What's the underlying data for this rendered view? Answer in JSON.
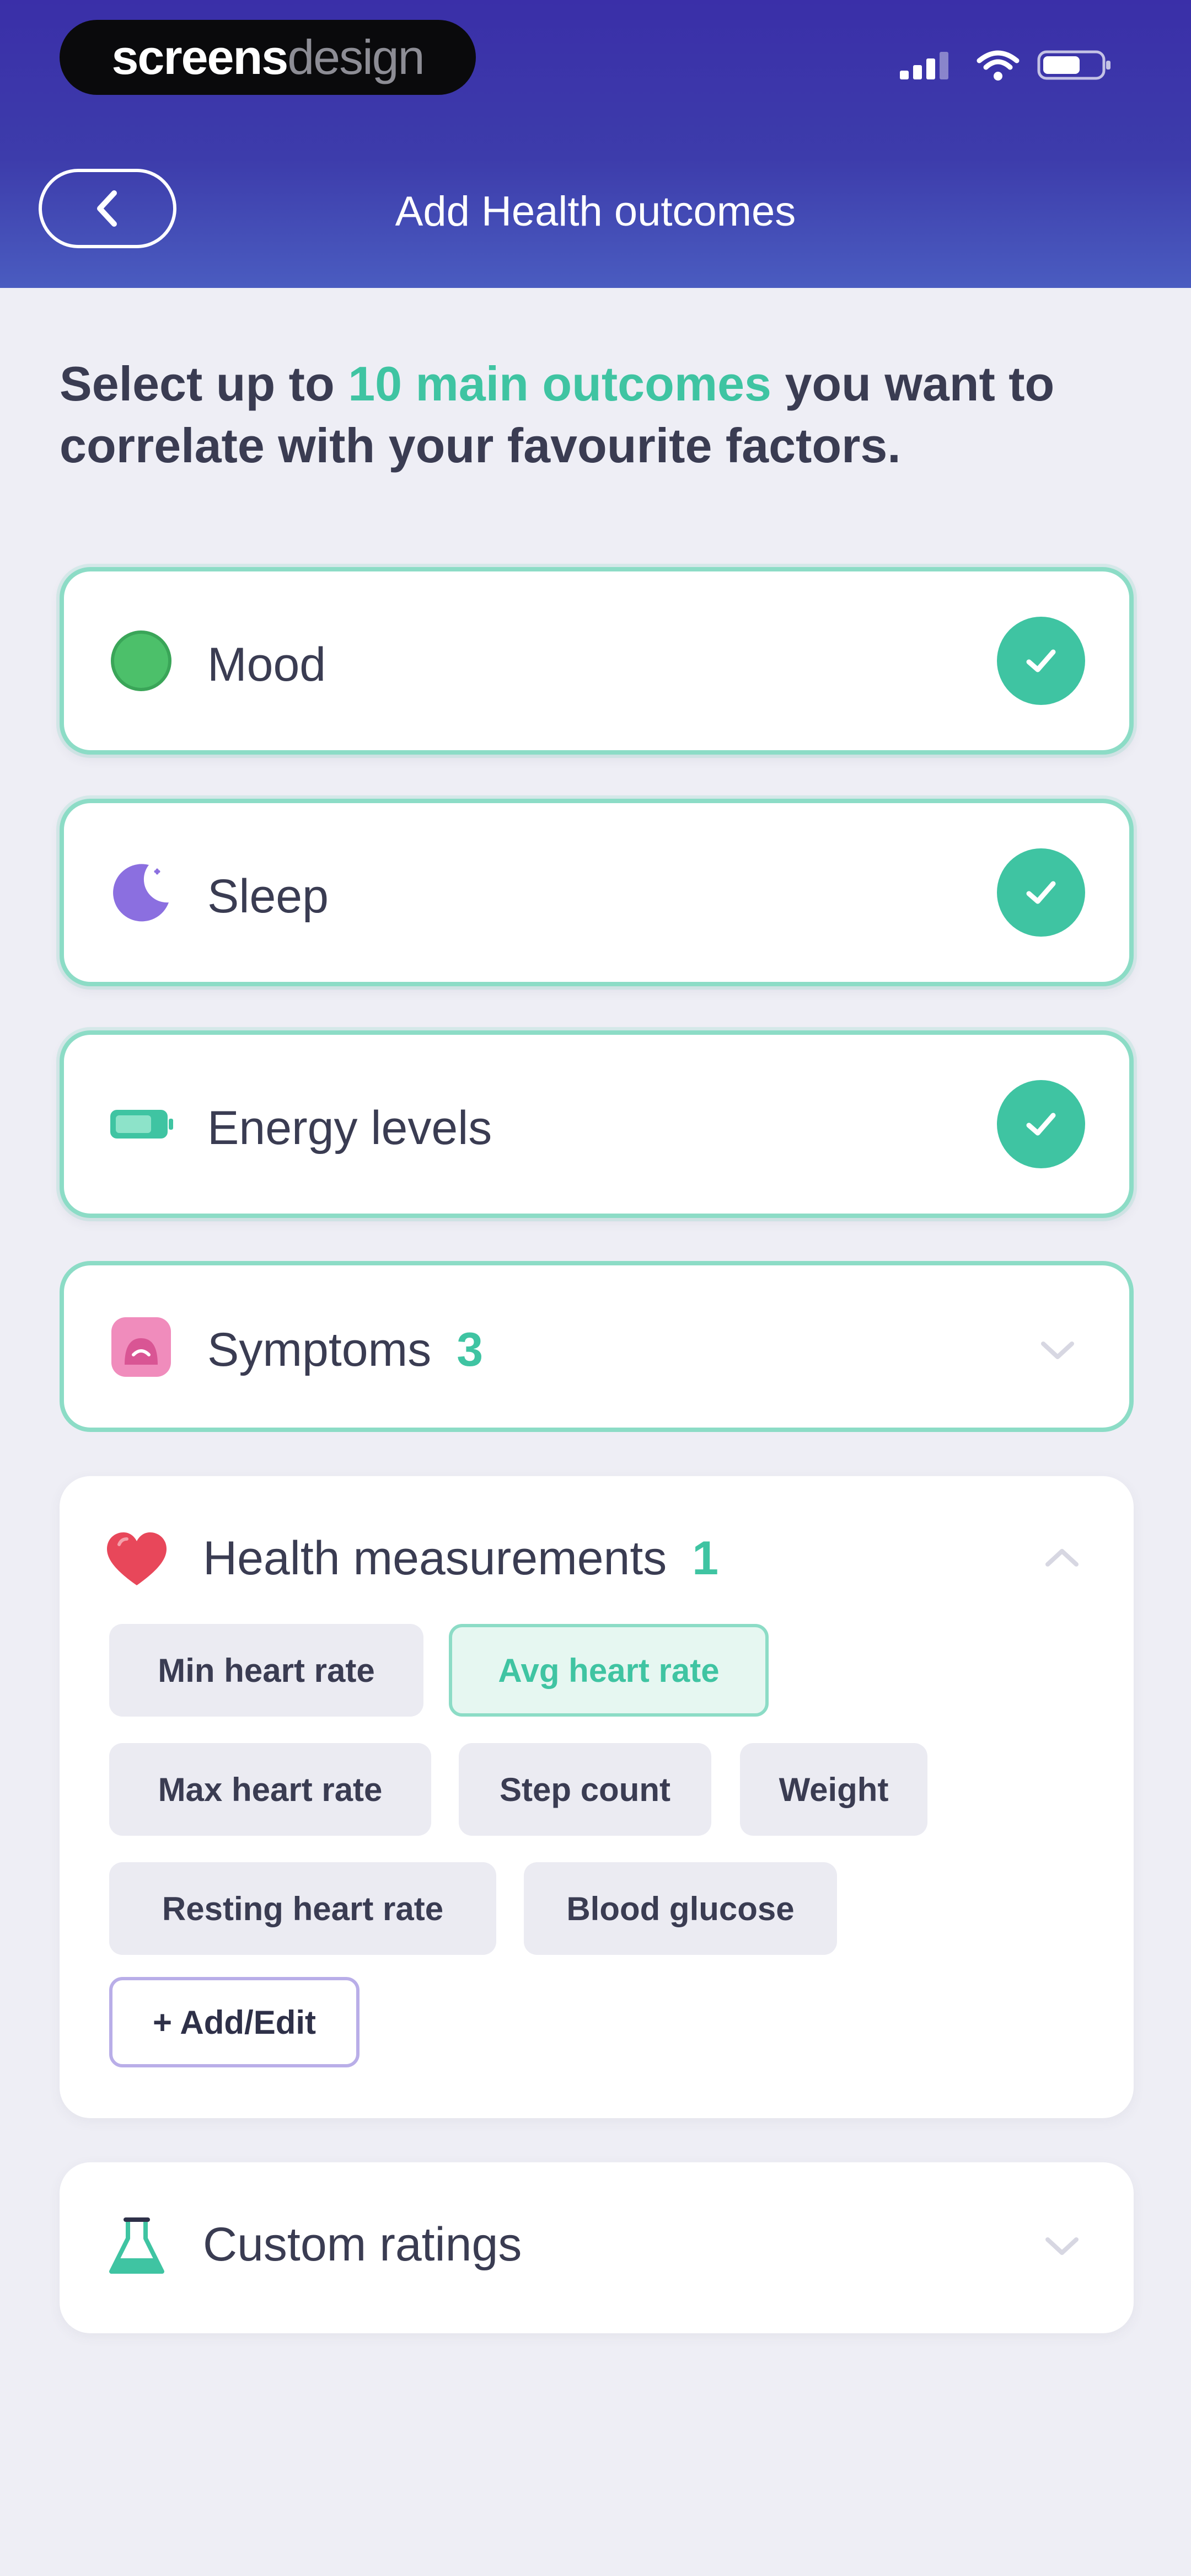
{
  "status_bar": {
    "brand_bold": "screens",
    "brand_light": "design"
  },
  "header": {
    "title": "Add Health outcomes"
  },
  "intro": {
    "before": "Select up to ",
    "highlight": "10 main outcomes",
    "after": " you want to correlate with your favourite factors."
  },
  "outcomes": {
    "mood": {
      "label": "Mood"
    },
    "sleep": {
      "label": "Sleep"
    },
    "energy": {
      "label": "Energy levels"
    },
    "symptoms": {
      "label": "Symptoms",
      "count": "3"
    },
    "health_measurements": {
      "label": "Health measurements",
      "count": "1",
      "chips": {
        "min_hr": "Min heart rate",
        "avg_hr": "Avg heart rate",
        "max_hr": "Max heart rate",
        "steps": "Step count",
        "weight": "Weight",
        "resting_hr": "Resting heart rate",
        "glucose": "Blood glucose",
        "add_edit": "+ Add/Edit"
      }
    },
    "custom": {
      "label": "Custom ratings"
    }
  },
  "colors": {
    "accent": "#3fc4a2",
    "header_top": "#3a2fa8",
    "header_bottom": "#4a5cc0",
    "background": "#eeeef5"
  }
}
